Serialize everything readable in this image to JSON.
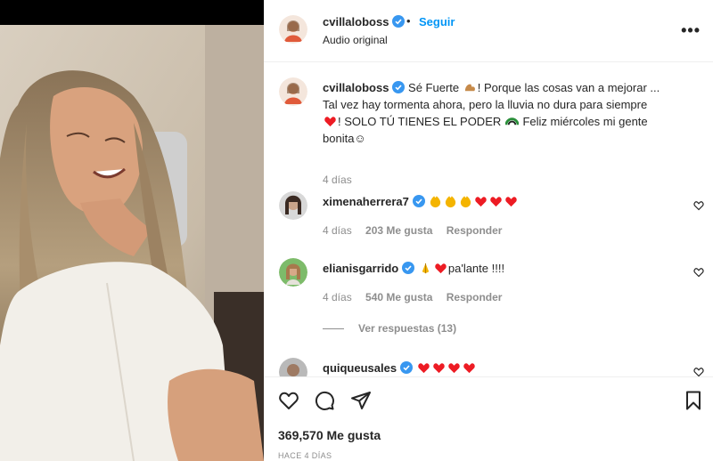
{
  "post": {
    "username": "cvillaloboss",
    "separator": "•",
    "follow_label": "Seguir",
    "audio": "Audio original",
    "more_label": "•••"
  },
  "caption": {
    "username": "cvillaloboss",
    "text_1": "Sé Fuerte ",
    "text_2": "! Porque las cosas van a mejorar ...",
    "text_3": "Tal vez hay tormenta ahora, pero la lluvia no dura para siempre",
    "text_4": "! SOLO TÚ TIENES EL PODER ",
    "text_5": " Feliz miércoles mi gente",
    "text_6": "bonita☺",
    "time": "4 días"
  },
  "comments": [
    {
      "username": "ximenaherrera7",
      "time": "4 días",
      "likes": "203 Me gusta",
      "reply": "Responder"
    },
    {
      "username": "elianisgarrido",
      "text": "pa'lante !!!!",
      "time": "4 días",
      "likes": "540 Me gusta",
      "reply": "Responder",
      "view_replies": "Ver respuestas (13)"
    },
    {
      "username": "quiqueusales"
    }
  ],
  "actions": {
    "likes": "369,570 Me gusta",
    "posted": "HACE 4 DÍAS"
  },
  "colors": {
    "accent": "#0095f6",
    "verified": "#3897f0",
    "heart": "#ed1c24",
    "muted": "#8e8e8e"
  }
}
